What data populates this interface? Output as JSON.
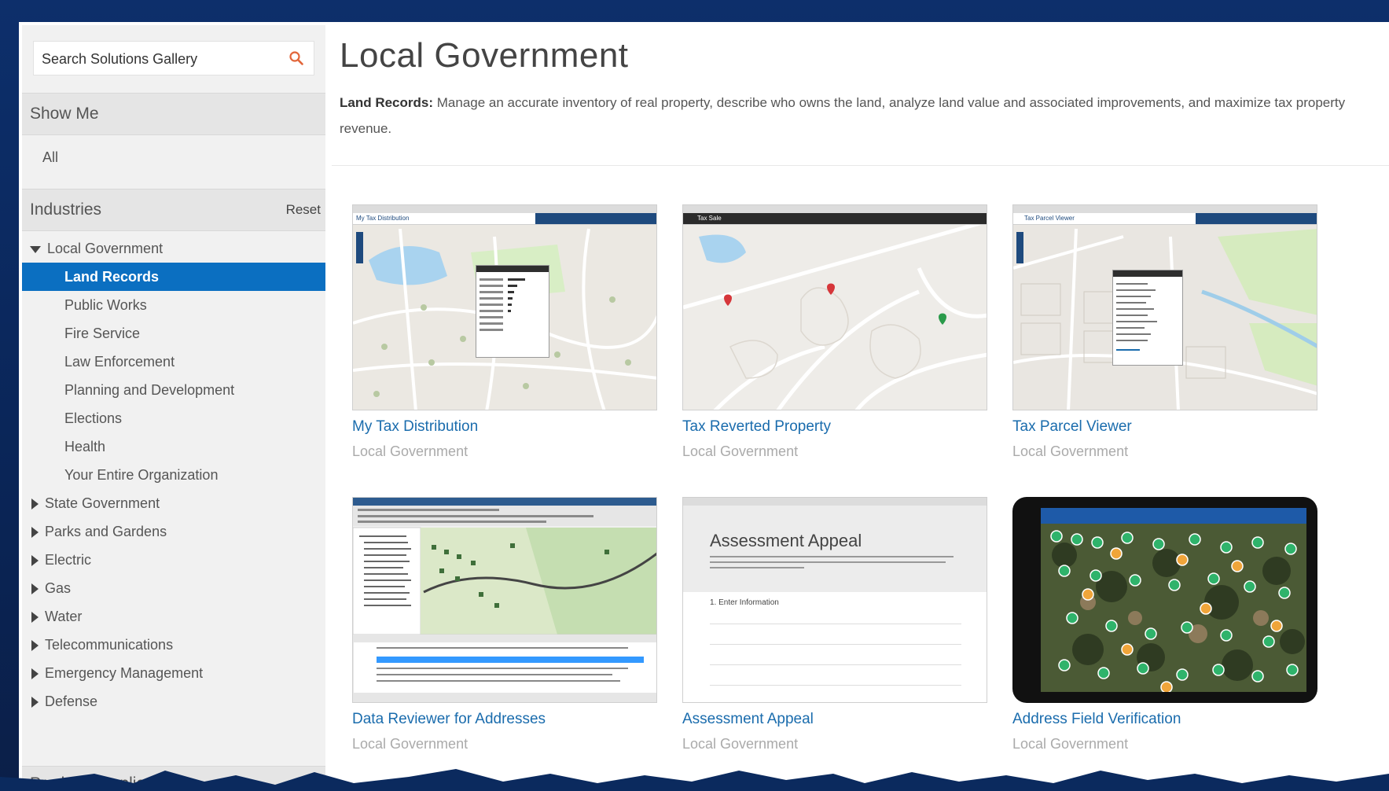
{
  "search": {
    "placeholder": "Search Solutions Gallery"
  },
  "sidebar": {
    "show_me": {
      "label": "Show Me",
      "items": [
        "All"
      ]
    },
    "industries": {
      "label": "Industries",
      "reset": "Reset",
      "expanded": "Local Government",
      "sub_items": [
        "Land Records",
        "Public Works",
        "Fire Service",
        "Law Enforcement",
        "Planning and Development",
        "Elections",
        "Health",
        "Your Entire Organization"
      ],
      "active_sub_item": "Land Records",
      "collapsed": [
        "State Government",
        "Parks and Gardens",
        "Electric",
        "Gas",
        "Water",
        "Telecommunications",
        "Emergency Management",
        "Defense"
      ]
    },
    "products": {
      "label": "Products/Applic"
    }
  },
  "main": {
    "title": "Local Government",
    "desc_bold": "Land Records:",
    "desc_text": "Manage an accurate inventory of real property, describe who owns the land, analyze land value and associated improvements, and maximize tax property revenue.",
    "cards": [
      {
        "title": "My Tax Distribution",
        "subtitle": "Local Government",
        "thumb_label": "My Tax Distribution"
      },
      {
        "title": "Tax Reverted Property",
        "subtitle": "Local Government",
        "thumb_label": "Tax Sale"
      },
      {
        "title": "Tax Parcel Viewer",
        "subtitle": "Local Government",
        "thumb_label": "Tax Parcel Viewer"
      },
      {
        "title": "Data Reviewer for Addresses",
        "subtitle": "Local Government"
      },
      {
        "title": "Assessment Appeal",
        "subtitle": "Local Government",
        "thumb_heading": "Assessment Appeal",
        "thumb_step": "1. Enter Information"
      },
      {
        "title": "Address Field Verification",
        "subtitle": "Local Government"
      }
    ]
  },
  "colors": {
    "active": "#0b6fc1",
    "link": "#1a6cad",
    "background": "#0d2f6b"
  }
}
